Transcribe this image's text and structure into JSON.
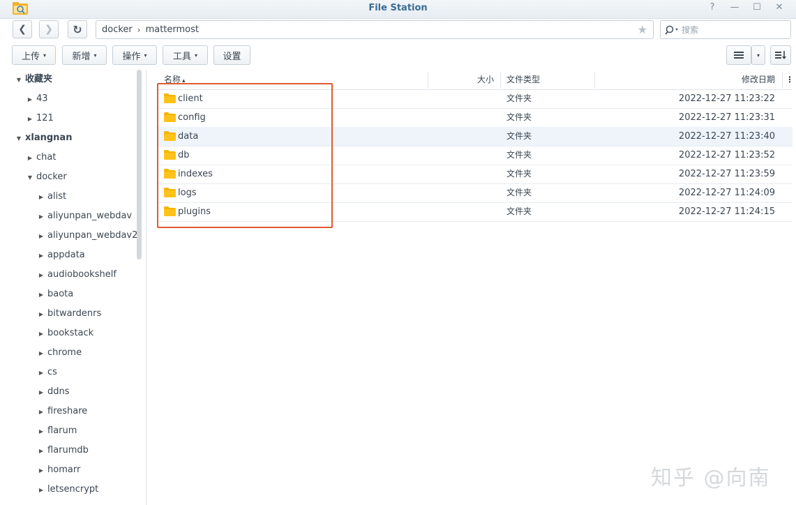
{
  "window": {
    "title": "File Station",
    "help_glyph": "?",
    "minimize_glyph": "—",
    "maximize_glyph": "☐",
    "close_glyph": "✕"
  },
  "nav": {
    "back_glyph": "❮",
    "forward_glyph": "❯",
    "refresh_glyph": "↻",
    "path": [
      "docker",
      "mattermost"
    ],
    "path_sep": "›",
    "favorite_glyph": "★",
    "search_placeholder": "搜索"
  },
  "toolbar": {
    "upload": "上传",
    "create": "新增",
    "action": "操作",
    "tools": "工具",
    "settings": "设置",
    "caret": "▾",
    "view_caret": "▾"
  },
  "sidebar": {
    "items": [
      {
        "label": "收藏夹",
        "level": 0,
        "expanded": true,
        "bold": true
      },
      {
        "label": "43",
        "level": 1,
        "expanded": false,
        "bold": false
      },
      {
        "label": "121",
        "level": 1,
        "expanded": false,
        "bold": false
      },
      {
        "label": "xlangnan",
        "level": 0,
        "expanded": true,
        "bold": true
      },
      {
        "label": "chat",
        "level": 1,
        "expanded": false,
        "bold": false
      },
      {
        "label": "docker",
        "level": 1,
        "expanded": true,
        "bold": false
      },
      {
        "label": "alist",
        "level": 2,
        "expanded": false,
        "bold": false
      },
      {
        "label": "aliyunpan_webdav",
        "level": 2,
        "expanded": false,
        "bold": false
      },
      {
        "label": "aliyunpan_webdav2",
        "level": 2,
        "expanded": false,
        "bold": false
      },
      {
        "label": "appdata",
        "level": 2,
        "expanded": false,
        "bold": false
      },
      {
        "label": "audiobookshelf",
        "level": 2,
        "expanded": false,
        "bold": false
      },
      {
        "label": "baota",
        "level": 2,
        "expanded": false,
        "bold": false
      },
      {
        "label": "bitwardenrs",
        "level": 2,
        "expanded": false,
        "bold": false
      },
      {
        "label": "bookstack",
        "level": 2,
        "expanded": false,
        "bold": false
      },
      {
        "label": "chrome",
        "level": 2,
        "expanded": false,
        "bold": false
      },
      {
        "label": "cs",
        "level": 2,
        "expanded": false,
        "bold": false
      },
      {
        "label": "ddns",
        "level": 2,
        "expanded": false,
        "bold": false
      },
      {
        "label": "fireshare",
        "level": 2,
        "expanded": false,
        "bold": false
      },
      {
        "label": "flarum",
        "level": 2,
        "expanded": false,
        "bold": false
      },
      {
        "label": "flarumdb",
        "level": 2,
        "expanded": false,
        "bold": false
      },
      {
        "label": "homarr",
        "level": 2,
        "expanded": false,
        "bold": false
      },
      {
        "label": "letsencrypt",
        "level": 2,
        "expanded": false,
        "bold": false
      }
    ]
  },
  "columns": {
    "name": "名称",
    "sort_glyph": "▴",
    "size": "大小",
    "type": "文件类型",
    "modified": "修改日期",
    "more_glyph": "⋮"
  },
  "files": [
    {
      "name": "client",
      "type": "文件夹",
      "modified": "2022-12-27 11:23:22",
      "selected": false
    },
    {
      "name": "config",
      "type": "文件夹",
      "modified": "2022-12-27 11:23:31",
      "selected": false
    },
    {
      "name": "data",
      "type": "文件夹",
      "modified": "2022-12-27 11:23:40",
      "selected": true
    },
    {
      "name": "db",
      "type": "文件夹",
      "modified": "2022-12-27 11:23:52",
      "selected": false
    },
    {
      "name": "indexes",
      "type": "文件夹",
      "modified": "2022-12-27 11:23:59",
      "selected": false
    },
    {
      "name": "logs",
      "type": "文件夹",
      "modified": "2022-12-27 11:24:09",
      "selected": false
    },
    {
      "name": "plugins",
      "type": "文件夹",
      "modified": "2022-12-27 11:24:15",
      "selected": false
    }
  ],
  "watermark": "知乎 @向南",
  "colors": {
    "folder": "#f5b400",
    "highlight": "#e05a30",
    "title": "#3b6a94"
  }
}
